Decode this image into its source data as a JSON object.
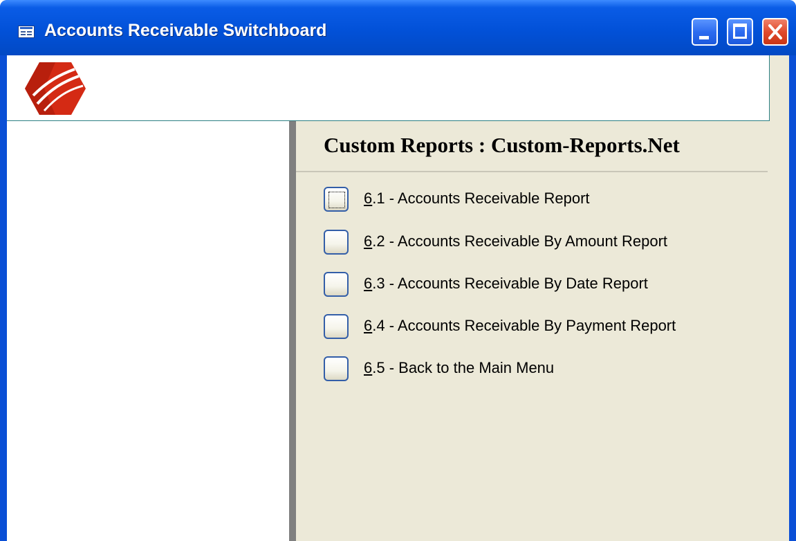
{
  "window": {
    "title": "Accounts Receivable Switchboard",
    "controls": [
      "minimize",
      "maximize",
      "close"
    ],
    "colors": {
      "titlebar": "#0251d8",
      "close": "#e04a2c",
      "client": "#ece9d8"
    }
  },
  "logo": {
    "icon": "red-hexagon-logo-icon",
    "color": "#d42a14"
  },
  "switchboard": {
    "heading": "Custom Reports : Custom-Reports.Net",
    "items": [
      {
        "accel": "6",
        "rest": ".1 - Accounts Receivable Report",
        "focused": true
      },
      {
        "accel": "6",
        "rest": ".2 - Accounts Receivable By Amount Report",
        "focused": false
      },
      {
        "accel": "6",
        "rest": ".3 - Accounts Receivable By Date Report",
        "focused": false
      },
      {
        "accel": "6",
        "rest": ".4 - Accounts Receivable By Payment Report",
        "focused": false
      },
      {
        "accel": "6",
        "rest": ".5 - Back to the Main Menu",
        "focused": false
      }
    ]
  }
}
